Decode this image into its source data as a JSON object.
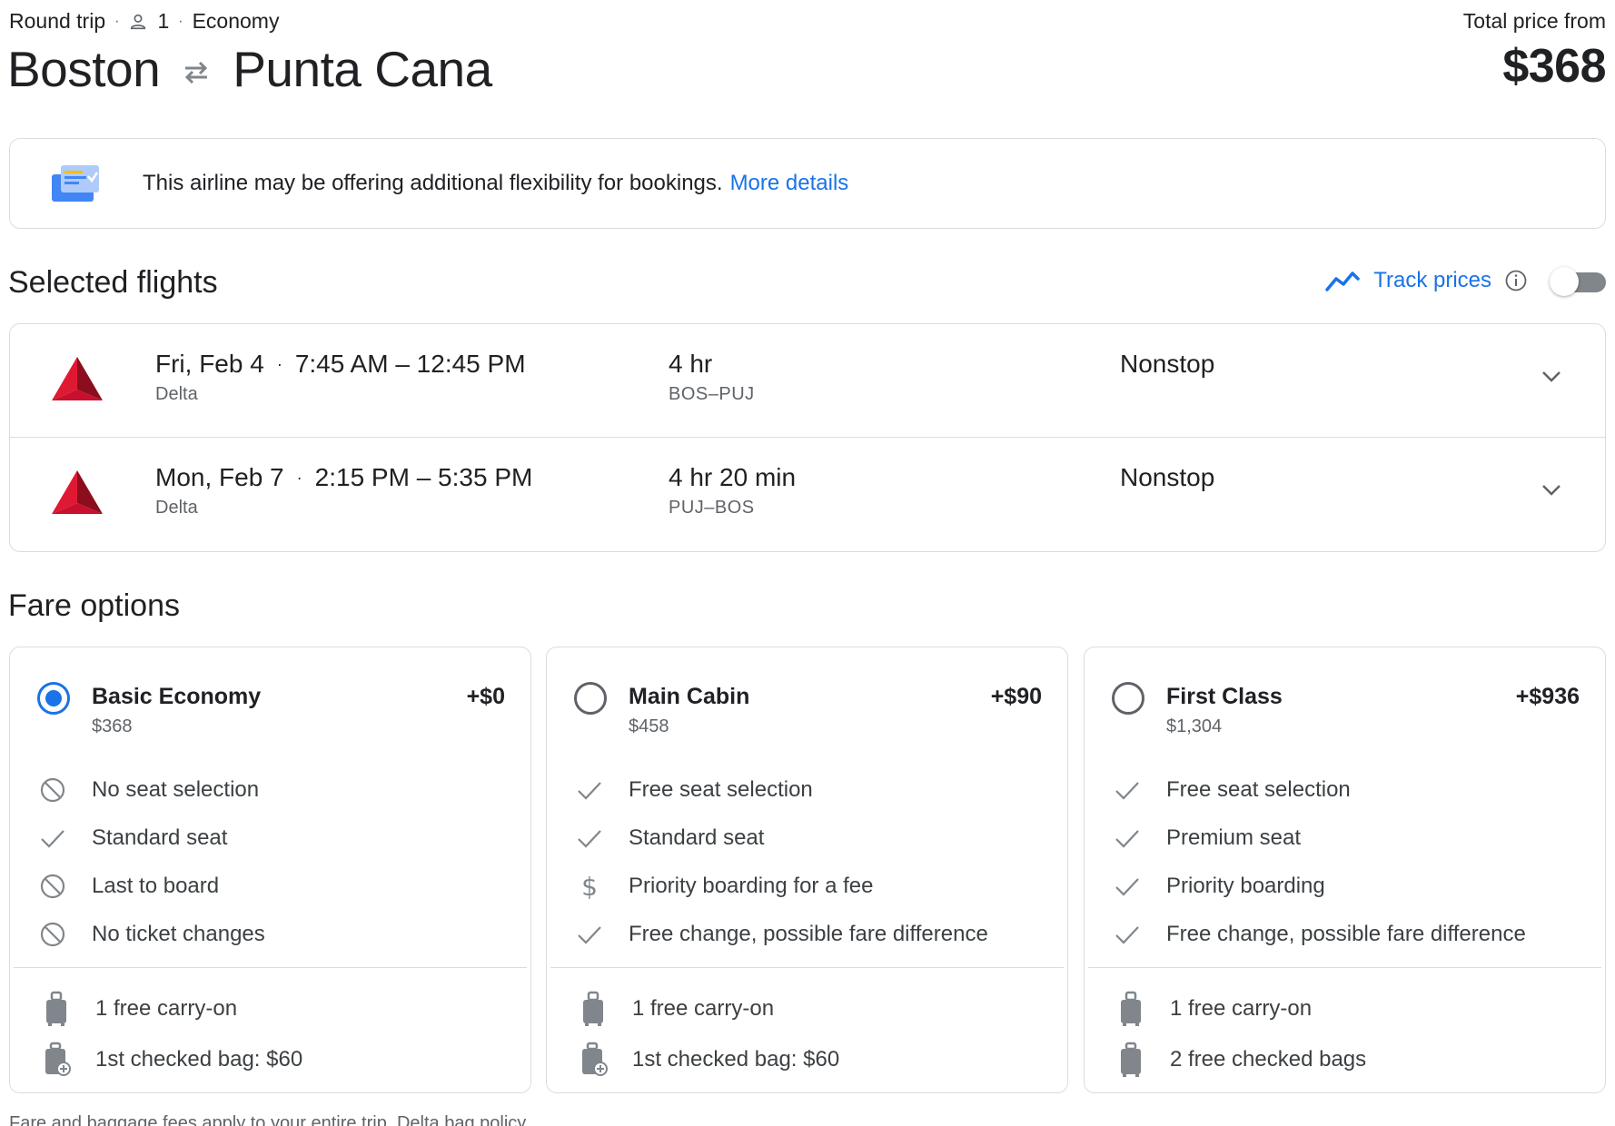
{
  "header": {
    "trip_type": "Round trip",
    "passengers": "1",
    "cabin": "Economy",
    "origin": "Boston",
    "destination": "Punta Cana",
    "price_label": "Total price from",
    "price": "$368"
  },
  "banner": {
    "text": "This airline may be offering additional flexibility for bookings.",
    "link": "More details"
  },
  "selected_flights": {
    "title": "Selected flights",
    "track_label": "Track prices",
    "track_enabled": false,
    "flights": [
      {
        "date": "Fri, Feb 4",
        "times": "7:45 AM – 12:45 PM",
        "airline": "Delta",
        "duration": "4 hr",
        "route": "BOS–PUJ",
        "stops": "Nonstop"
      },
      {
        "date": "Mon, Feb 7",
        "times": "2:15 PM – 5:35 PM",
        "airline": "Delta",
        "duration": "4 hr 20 min",
        "route": "PUJ–BOS",
        "stops": "Nonstop"
      }
    ]
  },
  "fare_options": {
    "title": "Fare options",
    "cards": [
      {
        "name": "Basic Economy",
        "price": "$368",
        "diff": "+$0",
        "selected": true,
        "features": [
          {
            "icon": "block-icon",
            "text": "No seat selection"
          },
          {
            "icon": "check-icon",
            "text": "Standard seat"
          },
          {
            "icon": "block-icon",
            "text": "Last to board"
          },
          {
            "icon": "block-icon",
            "text": "No ticket changes"
          }
        ],
        "bags": [
          {
            "icon": "carry-on-icon",
            "text": "1 free carry-on"
          },
          {
            "icon": "checked-bag-fee-icon",
            "text": "1st checked bag: $60"
          }
        ]
      },
      {
        "name": "Main Cabin",
        "price": "$458",
        "diff": "+$90",
        "selected": false,
        "features": [
          {
            "icon": "check-icon",
            "text": "Free seat selection"
          },
          {
            "icon": "check-icon",
            "text": "Standard seat"
          },
          {
            "icon": "dollar-icon",
            "text": "Priority boarding for a fee"
          },
          {
            "icon": "check-icon",
            "text": "Free change, possible fare difference"
          }
        ],
        "bags": [
          {
            "icon": "carry-on-icon",
            "text": "1 free carry-on"
          },
          {
            "icon": "checked-bag-fee-icon",
            "text": "1st checked bag: $60"
          }
        ]
      },
      {
        "name": "First Class",
        "price": "$1,304",
        "diff": "+$936",
        "selected": false,
        "features": [
          {
            "icon": "check-icon",
            "text": "Free seat selection"
          },
          {
            "icon": "check-icon",
            "text": "Premium seat"
          },
          {
            "icon": "check-icon",
            "text": "Priority boarding"
          },
          {
            "icon": "check-icon",
            "text": "Free change, possible fare difference"
          }
        ],
        "bags": [
          {
            "icon": "carry-on-icon",
            "text": "1 free carry-on"
          },
          {
            "icon": "checked-bag-icon",
            "text": "2 free checked bags"
          }
        ]
      }
    ]
  },
  "footer": {
    "text": "Fare and baggage fees apply to your entire trip.",
    "link": "Delta bag policy"
  },
  "colors": {
    "accent": "#1a73e8",
    "border": "#dadce0",
    "secondary_text": "#5f6368",
    "delta_red": "#c8102e"
  }
}
